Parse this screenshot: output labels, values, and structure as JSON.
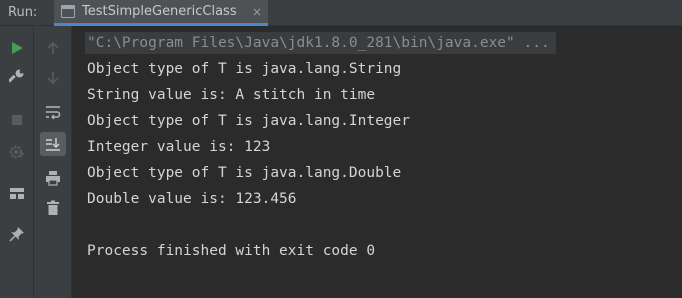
{
  "run_panel": {
    "label": "Run:",
    "tab": {
      "title": "TestSimpleGenericClass",
      "close_glyph": "×"
    }
  },
  "toolbar": {
    "left": [
      {
        "name": "rerun-icon",
        "color": "#499c54"
      },
      {
        "name": "wrench-icon",
        "color": "#afb1b3"
      },
      {
        "name": "stop-icon",
        "color": "#5b5b5b"
      },
      {
        "name": "debug-gear-icon",
        "color": "#5b5b5b"
      },
      {
        "name": "layout-icon",
        "color": "#afb1b3"
      },
      {
        "name": "pin-icon",
        "color": "#afb1b3"
      }
    ],
    "mid": [
      {
        "name": "up-arrow-icon",
        "color": "#5b5b5b"
      },
      {
        "name": "down-arrow-icon",
        "color": "#5b5b5b"
      },
      {
        "name": "soft-wrap-icon",
        "color": "#afb1b3"
      },
      {
        "name": "scroll-to-end-icon",
        "color": "#afb1b3"
      },
      {
        "name": "print-icon",
        "color": "#afb1b3"
      },
      {
        "name": "trash-icon",
        "color": "#afb1b3"
      }
    ]
  },
  "console": {
    "command": "\"C:\\Program Files\\Java\\jdk1.8.0_281\\bin\\java.exe\" ...",
    "lines": [
      "Object type of T is java.lang.String",
      "String value is: A stitch in time",
      "Object type of T is java.lang.Integer",
      "Integer value is: 123",
      "Object type of T is java.lang.Double",
      "Double value is: 123.456",
      "",
      "Process finished with exit code 0"
    ]
  }
}
